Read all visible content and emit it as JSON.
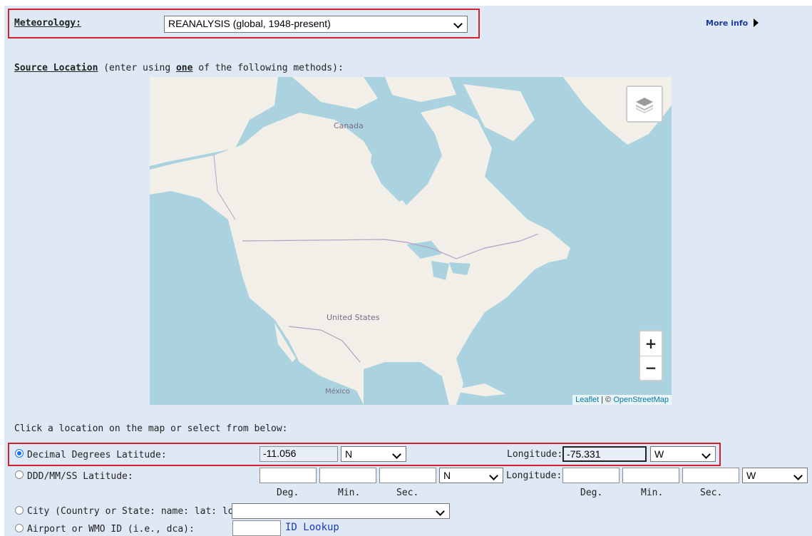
{
  "meteorology": {
    "label": "Meteorology:",
    "selected": "REANALYSIS (global, 1948-present)",
    "more_info": "More info"
  },
  "source_location": {
    "label": "Source Location",
    "hint_prefix": " (enter using ",
    "hint_emph": "one",
    "hint_suffix": " of the following methods):"
  },
  "map": {
    "labels": {
      "canada": "Canada",
      "united_states": "United States",
      "mexico": "México"
    },
    "zoom_in": "+",
    "zoom_out": "−",
    "attribution_leaflet": "Leaflet",
    "attribution_sep": " | © ",
    "attribution_osm": "OpenStreetMap"
  },
  "instruction": "Click a location on the map or select from below:",
  "decimal": {
    "label": "Decimal Degrees Latitude:",
    "lat_value": "-11.056",
    "lat_dir": "N",
    "lon_label": "Longitude:",
    "lon_value": "-75.331",
    "lon_dir": "W"
  },
  "ddd": {
    "label": "DDD/MM/SS Latitude:",
    "lat_dir": "N",
    "lon_label": "Longitude:",
    "lon_dir": "W",
    "deg": "Deg.",
    "min": "Min.",
    "sec": "Sec."
  },
  "city": {
    "label": "City (Country or State: name: lat: lon):",
    "selected": ""
  },
  "airport": {
    "label": "Airport or WMO ID (i.e., dca):",
    "lookup": "ID Lookup"
  }
}
